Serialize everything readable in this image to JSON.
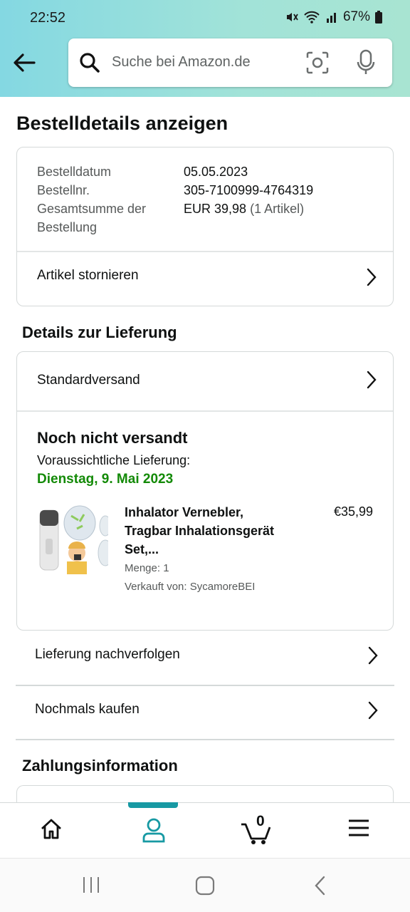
{
  "status_bar": {
    "time": "22:52",
    "battery": "67%"
  },
  "search": {
    "placeholder": "Suche bei Amazon.de"
  },
  "page_title": "Bestelldetails anzeigen",
  "order_summary": {
    "rows": [
      {
        "label": "Bestelldatum",
        "value": "05.05.2023"
      },
      {
        "label": "Bestellnr.",
        "value": "305-7100999-4764319"
      },
      {
        "label_line1": "Gesamtsumme der",
        "label_line2": "Bestellung",
        "value": "EUR 39,98",
        "value_suffix": "(1 Artikel)"
      }
    ],
    "cancel_link": "Artikel stornieren"
  },
  "delivery": {
    "section_title": "Details zur Lieferung",
    "shipping_method": "Standardversand",
    "status_title": "Noch nicht versandt",
    "eta_label": "Voraussichtliche Lieferung:",
    "eta_date": "Dienstag, 9. Mai 2023",
    "item": {
      "title_line1": "Inhalator Vernebler,",
      "title_line2": "Tragbar Inhalationsgerät",
      "title_line3": "Set,...",
      "price": "€35,99",
      "quantity": "Menge: 1",
      "seller": "Verkauft von: SycamoreBEI"
    }
  },
  "actions": {
    "track": "Lieferung nachverfolgen",
    "buy_again": "Nochmals kaufen"
  },
  "payment": {
    "section_title": "Zahlungsinformation"
  },
  "bottom_nav": {
    "cart_count": "0",
    "active": "account"
  },
  "colors": {
    "accent": "#1799a3",
    "delivery_green": "#138a07",
    "header_start": "#84d8e2",
    "header_end": "#a8e4d2"
  }
}
